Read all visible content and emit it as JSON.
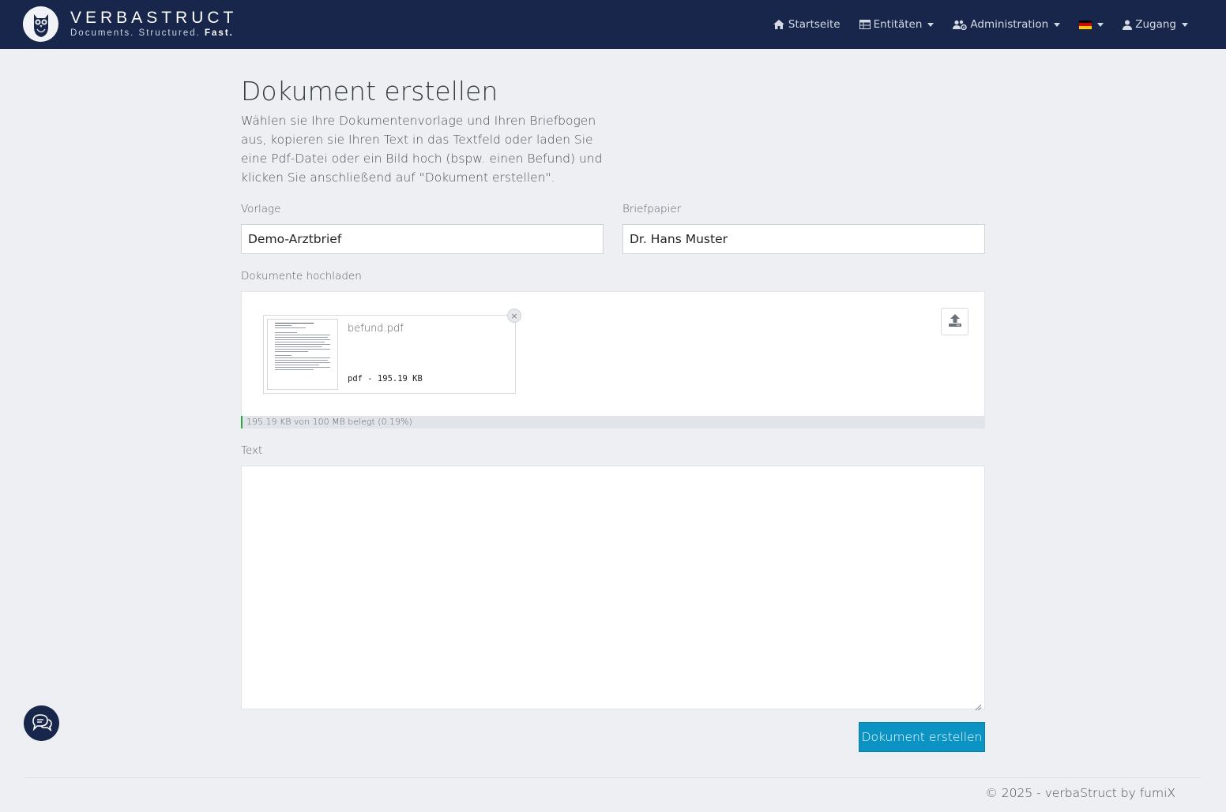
{
  "brand": {
    "name": "VERBASTRUCT",
    "tagline_prefix": "Documents. Structured.",
    "tagline_emphasis": "Fast."
  },
  "nav": {
    "home": "Startseite",
    "entities": "Entitäten",
    "administration": "Administration",
    "language": "de",
    "access": "Zugang"
  },
  "page": {
    "title": "Dokument erstellen",
    "intro": "Wählen sie Ihre Dokumentenvorlage und Ihren Briefbogen aus, kopieren sie Ihren Text in das Textfeld oder laden Sie eine Pdf-Datei oder ein Bild hoch (bspw. einen Befund) und klicken Sie anschließend auf \"Dokument erstellen\"."
  },
  "form": {
    "template_label": "Vorlage",
    "template_value": "Demo-Arztbrief",
    "letterhead_label": "Briefpapier",
    "letterhead_value": "Dr. Hans Muster",
    "upload_label": "Dokumente hochladen",
    "file": {
      "name": "befund.pdf",
      "meta": "pdf - 195.19 KB"
    },
    "quota_text": "195.19 KB von 100 MB belegt (0.19%)",
    "quota_percent": 0.19,
    "text_label": "Text",
    "text_value": "",
    "submit_label": "Dokument erstellen"
  },
  "footer": {
    "text": "© 2025 - verbaStruct by fumiX"
  },
  "colors": {
    "navbar": "#17264a",
    "primary_button": "#0a93c3",
    "progress": "#28a745",
    "background": "#edeff3"
  }
}
